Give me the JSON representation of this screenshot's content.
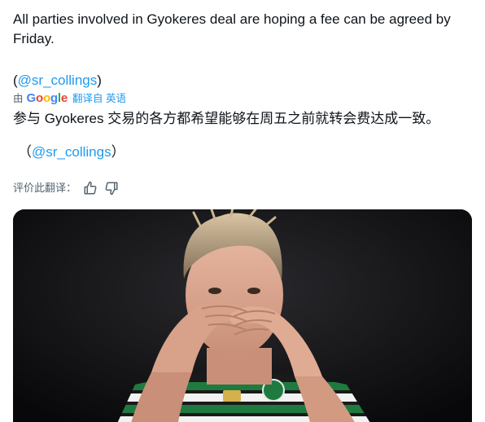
{
  "tweet": {
    "line1": "All parties involved in Gyokeres deal are hoping a fee can be agreed by",
    "line2": "Friday.",
    "mention_open": "(",
    "mention": "@sr_collings",
    "mention_close": ")"
  },
  "translation": {
    "by": "由",
    "google_letters": [
      "G",
      "o",
      "o",
      "g",
      "l",
      "e"
    ],
    "translated_from": "翻译自 英语",
    "text": "参与 Gyokeres 交易的各方都希望能够在周五之前就转会费达成一致。",
    "mention_open": "（",
    "mention": "@sr_collings",
    "mention_close": "）"
  },
  "rating": {
    "label": "评价此翻译：",
    "thumbs_up_icon": "thumbs-up-icon",
    "thumbs_down_icon": "thumbs-down-icon"
  },
  "media": {
    "icon": "photo-footballer",
    "kit_colors": {
      "green": "#1f7a3f",
      "white": "#f2f2f2"
    }
  },
  "colors": {
    "text": "#0f1419",
    "link": "#1d9bf0",
    "secondary": "#536471"
  }
}
